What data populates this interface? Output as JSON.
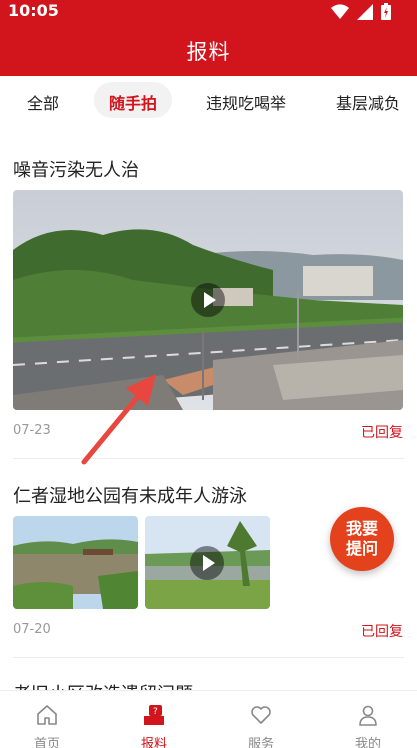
{
  "status_bar": {
    "time": "10:05"
  },
  "header": {
    "title": "报料"
  },
  "tabs": [
    {
      "label": "全部"
    },
    {
      "label": "随手拍"
    },
    {
      "label": "违规吃喝举"
    },
    {
      "label": "基层减负"
    }
  ],
  "posts": [
    {
      "title": "噪音污染无人治",
      "date": "07-23",
      "status": "已回复"
    },
    {
      "title": "仁者湿地公园有未成年人游泳",
      "date": "07-20",
      "status": "已回复"
    },
    {
      "title": "老旧小区改造遗留问题"
    }
  ],
  "fab": {
    "line1": "我要",
    "line2": "提问"
  },
  "bottom_nav": [
    {
      "label": "首页"
    },
    {
      "label": "报料"
    },
    {
      "label": "服务"
    },
    {
      "label": "我的"
    }
  ],
  "colors": {
    "brand_red": "#d2141c",
    "fab_orange": "#e3421d",
    "annotation_arrow": "#e8473f"
  }
}
